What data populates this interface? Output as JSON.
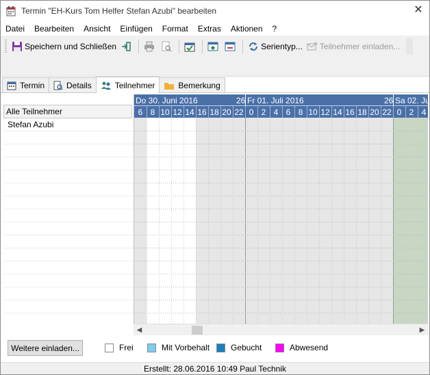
{
  "window": {
    "title": "Termin \"EH-Kurs Tom Helfer Stefan Azubi\" bearbeiten",
    "close_glyph": "✕"
  },
  "menu": [
    "Datei",
    "Bearbeiten",
    "Ansicht",
    "Einfügen",
    "Format",
    "Extras",
    "Aktionen",
    "?"
  ],
  "toolbar": {
    "save_close": "Speichern und Schließen",
    "series": "Serientyp...",
    "invite": "Teilnehmer einladen..."
  },
  "tabs": [
    {
      "label": "Termin",
      "icon": "calendar-icon"
    },
    {
      "label": "Details",
      "icon": "details-icon"
    },
    {
      "label": "Teilnehmer",
      "icon": "people-icon"
    },
    {
      "label": "Bemerkung",
      "icon": "folder-icon"
    }
  ],
  "participants": {
    "header": "Alle Teilnehmer",
    "rows": [
      "Stefan Azubi"
    ]
  },
  "schedule": {
    "dates": [
      {
        "label": "Do 30. Juni 2016",
        "end_hour": "26"
      },
      {
        "label": "Fr 01. Juli 2016",
        "end_hour": "26"
      },
      {
        "label": "Sa 02. Jul",
        "end_hour": ""
      }
    ],
    "hours_day1": [
      "6",
      "8",
      "10",
      "12",
      "14",
      "16",
      "18",
      "20",
      "22"
    ],
    "hours_day2": [
      "0",
      "2",
      "4",
      "6",
      "8",
      "10",
      "12",
      "14",
      "16",
      "18",
      "20",
      "22"
    ],
    "hours_day3": [
      "0",
      "2",
      "4"
    ]
  },
  "bottom": {
    "invite_more": "Weitere einladen...",
    "legend": [
      {
        "label": "Frei",
        "color": "#ffffff"
      },
      {
        "label": "Mit Vorbehalt",
        "color": "#7ecbf0"
      },
      {
        "label": "Gebucht",
        "color": "#1a7fc1"
      },
      {
        "label": "Abwesend",
        "color": "#ff00ff"
      }
    ]
  },
  "status": "Erstellt: 28.06.2016 10:49 Paul Technik",
  "colors": {
    "header_blue": "#4a70a8",
    "nonwork_gray": "#e6e6e6",
    "weekend_green": "#c8d6c4"
  }
}
